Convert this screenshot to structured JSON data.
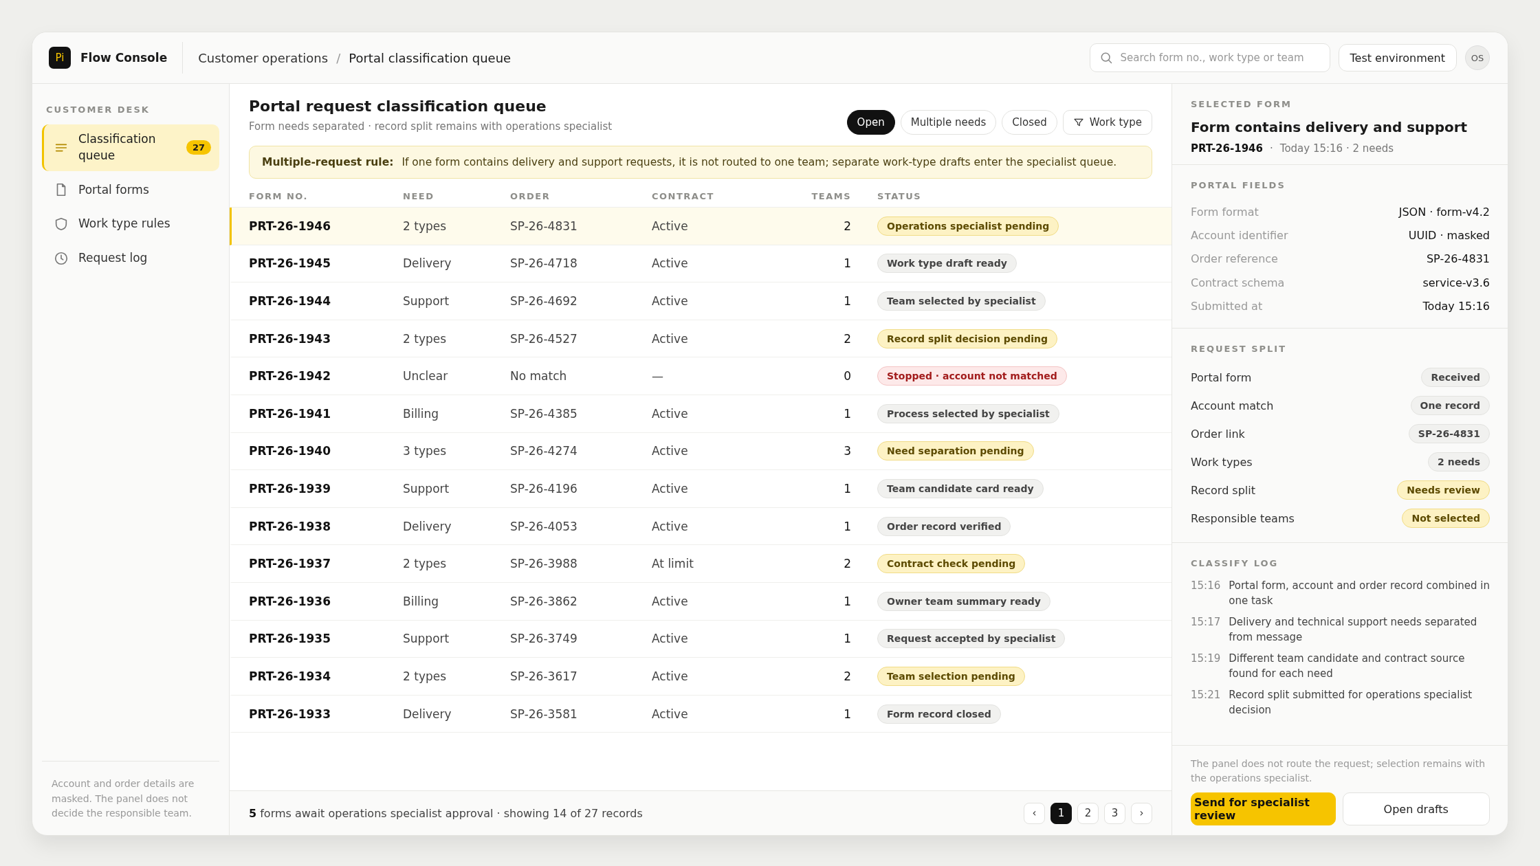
{
  "app": {
    "logo": "Pi",
    "name": "Flow Console"
  },
  "breadcrumb": {
    "items": [
      "Customer operations",
      "Portal classification queue"
    ],
    "separator": "/"
  },
  "search": {
    "placeholder": "Search form no., work type or team"
  },
  "environment": "Test environment",
  "user": {
    "initials": "OS"
  },
  "sidebar": {
    "heading": "CUSTOMER DESK",
    "items": [
      {
        "label": "Classification queue",
        "selected": true,
        "badge": "27"
      },
      {
        "label": "Portal forms",
        "selected": false
      },
      {
        "label": "Work type rules",
        "selected": false
      },
      {
        "label": "Request log",
        "selected": false
      }
    ],
    "note": "Account and order details are masked. The panel does not decide the responsible team."
  },
  "main": {
    "title": "Portal request classification queue",
    "subtitle": "Form needs separated · record split remains with operations specialist",
    "filters": [
      {
        "label": "Open",
        "kind": "toggle",
        "selected": true
      },
      {
        "label": "Multiple needs",
        "kind": "toggle",
        "selected": false
      },
      {
        "label": "Closed",
        "kind": "toggle",
        "selected": false
      },
      {
        "label": "Work type",
        "kind": "filter",
        "selected": false
      }
    ],
    "rule": {
      "label": "Multiple-request rule:",
      "text": "If one form contains delivery and support requests, it is not routed to one team; separate work-type drafts enter the specialist queue."
    }
  },
  "table": {
    "columns": [
      "FORM NO.",
      "NEED",
      "ORDER",
      "CONTRACT",
      "TEAMS",
      "STATUS"
    ],
    "rows": [
      {
        "form_no": "PRT-26-1946",
        "need": "2 types",
        "order": "SP-26-4831",
        "contract": "Active",
        "teams": "2",
        "status": "Operations specialist pending",
        "kind": "warn",
        "selected": true
      },
      {
        "form_no": "PRT-26-1945",
        "need": "Delivery",
        "order": "SP-26-4718",
        "contract": "Active",
        "teams": "1",
        "status": "Work type draft ready",
        "kind": "neutral",
        "selected": false
      },
      {
        "form_no": "PRT-26-1944",
        "need": "Support",
        "order": "SP-26-4692",
        "contract": "Active",
        "teams": "1",
        "status": "Team selected by specialist",
        "kind": "neutral",
        "selected": false
      },
      {
        "form_no": "PRT-26-1943",
        "need": "2 types",
        "order": "SP-26-4527",
        "contract": "Active",
        "teams": "2",
        "status": "Record split decision pending",
        "kind": "warn",
        "selected": false
      },
      {
        "form_no": "PRT-26-1942",
        "need": "Unclear",
        "order": "No match",
        "contract": "—",
        "teams": "0",
        "status": "Stopped · account not matched",
        "kind": "error",
        "selected": false
      },
      {
        "form_no": "PRT-26-1941",
        "need": "Billing",
        "order": "SP-26-4385",
        "contract": "Active",
        "teams": "1",
        "status": "Process selected by specialist",
        "kind": "neutral",
        "selected": false
      },
      {
        "form_no": "PRT-26-1940",
        "need": "3 types",
        "order": "SP-26-4274",
        "contract": "Active",
        "teams": "3",
        "status": "Need separation pending",
        "kind": "warn",
        "selected": false
      },
      {
        "form_no": "PRT-26-1939",
        "need": "Support",
        "order": "SP-26-4196",
        "contract": "Active",
        "teams": "1",
        "status": "Team candidate card ready",
        "kind": "neutral",
        "selected": false
      },
      {
        "form_no": "PRT-26-1938",
        "need": "Delivery",
        "order": "SP-26-4053",
        "contract": "Active",
        "teams": "1",
        "status": "Order record verified",
        "kind": "neutral",
        "selected": false
      },
      {
        "form_no": "PRT-26-1937",
        "need": "2 types",
        "order": "SP-26-3988",
        "contract": "At limit",
        "teams": "2",
        "status": "Contract check pending",
        "kind": "warn",
        "selected": false
      },
      {
        "form_no": "PRT-26-1936",
        "need": "Billing",
        "order": "SP-26-3862",
        "contract": "Active",
        "teams": "1",
        "status": "Owner team summary ready",
        "kind": "neutral",
        "selected": false
      },
      {
        "form_no": "PRT-26-1935",
        "need": "Support",
        "order": "SP-26-3749",
        "contract": "Active",
        "teams": "1",
        "status": "Request accepted by specialist",
        "kind": "neutral",
        "selected": false
      },
      {
        "form_no": "PRT-26-1934",
        "need": "2 types",
        "order": "SP-26-3617",
        "contract": "Active",
        "teams": "2",
        "status": "Team selection pending",
        "kind": "warn",
        "selected": false
      },
      {
        "form_no": "PRT-26-1933",
        "need": "Delivery",
        "order": "SP-26-3581",
        "contract": "Active",
        "teams": "1",
        "status": "Form record closed",
        "kind": "neutral",
        "selected": false
      }
    ]
  },
  "footer": {
    "summary": "**5** forms await operations specialist approval · showing 14 of 27 records",
    "prev": "‹",
    "next": "›",
    "pages": [
      {
        "label": "1",
        "selected": true
      },
      {
        "label": "2",
        "selected": false
      },
      {
        "label": "3",
        "selected": false
      }
    ]
  },
  "details": {
    "heading": "SELECTED FORM",
    "title": "Form contains delivery and support",
    "form_no": "PRT-26-1946",
    "separator": "·",
    "meta": "Today 15:16 · 2 needs",
    "fields_heading": "PORTAL FIELDS",
    "fields": [
      {
        "label": "Form format",
        "value": "JSON · form-v4.2"
      },
      {
        "label": "Account identifier",
        "value": "UUID · masked"
      },
      {
        "label": "Order reference",
        "value": "SP-26-4831"
      },
      {
        "label": "Contract schema",
        "value": "service-v3.6"
      },
      {
        "label": "Submitted at",
        "value": "Today 15:16"
      }
    ],
    "split_heading": "REQUEST SPLIT",
    "split": [
      {
        "label": "Portal form",
        "value": "Received",
        "kind": "neutral"
      },
      {
        "label": "Account match",
        "value": "One record",
        "kind": "neutral"
      },
      {
        "label": "Order link",
        "value": "SP-26-4831",
        "kind": "neutral"
      },
      {
        "label": "Work types",
        "value": "2 needs",
        "kind": "neutral"
      },
      {
        "label": "Record split",
        "value": "Needs review",
        "kind": "warn"
      },
      {
        "label": "Responsible teams",
        "value": "Not selected",
        "kind": "warn"
      }
    ],
    "log_heading": "CLASSIFY LOG",
    "log": [
      {
        "time": "15:16",
        "text": "Portal form, account and order record combined in one task"
      },
      {
        "time": "15:17",
        "text": "Delivery and technical support needs separated from message"
      },
      {
        "time": "15:19",
        "text": "Different team candidate and contract source found for each need"
      },
      {
        "time": "15:21",
        "text": "Record split submitted for operations specialist decision"
      }
    ],
    "note": "The panel does not route the request; selection remains with the operations specialist.",
    "primary_action": "Send for specialist review",
    "secondary_action": "Open drafts"
  }
}
